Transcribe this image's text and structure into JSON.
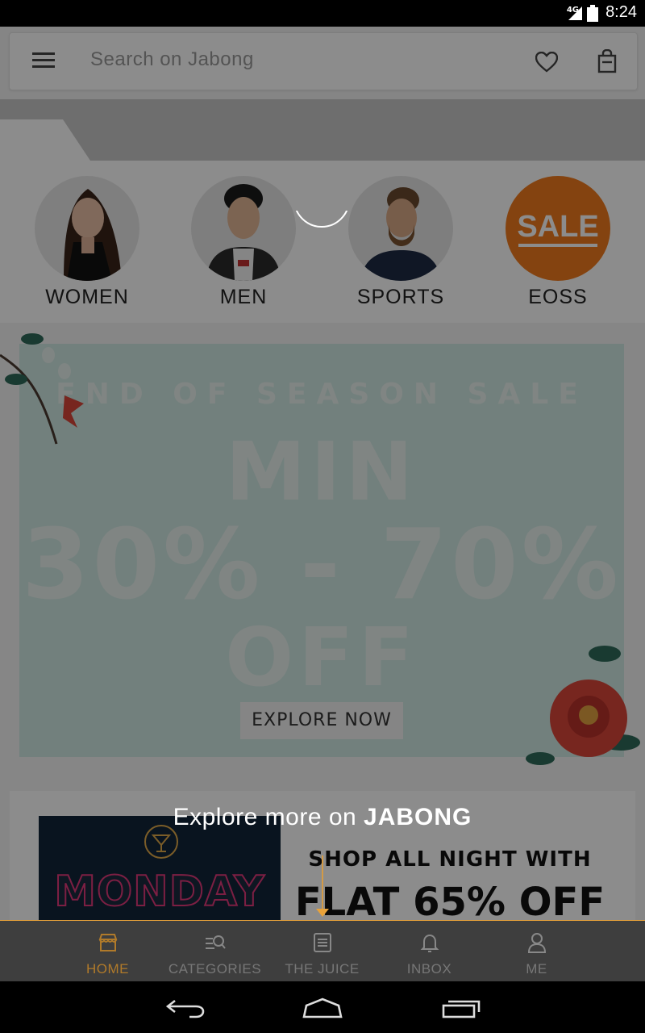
{
  "status_bar": {
    "network": "4G",
    "time": "8:24"
  },
  "search": {
    "placeholder": "Search on Jabong"
  },
  "categories": [
    {
      "label": "WOMEN"
    },
    {
      "label": "MEN"
    },
    {
      "label": "SPORTS"
    },
    {
      "label": "EOSS",
      "badge": "SALE"
    }
  ],
  "banner": {
    "line1": "END OF SEASON SALE",
    "line2": "MIN",
    "line3": "30% - 70%",
    "line4": "OFF",
    "cta": "EXPLORE NOW"
  },
  "promo2": {
    "image_text": "MONDAY",
    "line1": "SHOP ALL NIGHT WITH",
    "line2": "FLAT 65% OFF"
  },
  "overlay": {
    "prefix": "Explore more on",
    "brand": "JABONG"
  },
  "bottom_nav": [
    {
      "label": "HOME"
    },
    {
      "label": "CATEGORIES"
    },
    {
      "label": "THE JUICE"
    },
    {
      "label": "INBOX"
    },
    {
      "label": "ME"
    }
  ],
  "colors": {
    "accent": "#e8a23a",
    "sale_orange": "#f07b1e",
    "banner_mint": "#cfe9e3"
  }
}
